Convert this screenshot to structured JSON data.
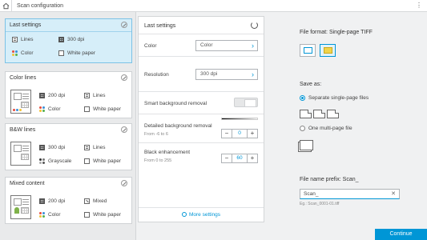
{
  "topbar": {
    "title": "Scan configuration",
    "more_icon": "⋮"
  },
  "presets": [
    {
      "title": "Last settings",
      "opt1": "Lines",
      "opt2": "300 dpi",
      "opt3": "Color",
      "opt4": "White paper"
    },
    {
      "title": "Color lines",
      "opt1": "200 dpi",
      "opt2": "Lines",
      "opt3": "Color",
      "opt4": "White paper"
    },
    {
      "title": "B&W lines",
      "opt1": "300 dpi",
      "opt2": "Lines",
      "opt3": "Grayscale",
      "opt4": "White paper"
    },
    {
      "title": "Mixed content",
      "opt1": "200 dpi",
      "opt2": "Mixed",
      "opt3": "Color",
      "opt4": "White paper"
    }
  ],
  "settings": {
    "title": "Last settings",
    "color": {
      "label": "Color",
      "value": "Color"
    },
    "resolution": {
      "label": "Resolution",
      "value": "300 dpi"
    },
    "smart_bg": {
      "label": "Smart background removal"
    },
    "detailed_bg": {
      "label": "Detailed background removal",
      "range": "From -6 to 6",
      "value": "0"
    },
    "black": {
      "label": "Black enhancement",
      "range": "From 0 to 255",
      "value": "60"
    },
    "more": "More settings"
  },
  "output": {
    "file_format": "File format: Single-page TIFF",
    "save_as": "Save as:",
    "opt_separate": "Separate single-page files",
    "opt_multi": "One multi-page file",
    "prefix_label": "File name prefix: Scan_",
    "prefix_value": "Scan_",
    "prefix_hint": "Eg.: Scan_0001-01.tiff"
  },
  "continue_label": "Continue",
  "colors": {
    "accent": "#0096d6",
    "selected_card": "#d6eef9"
  }
}
